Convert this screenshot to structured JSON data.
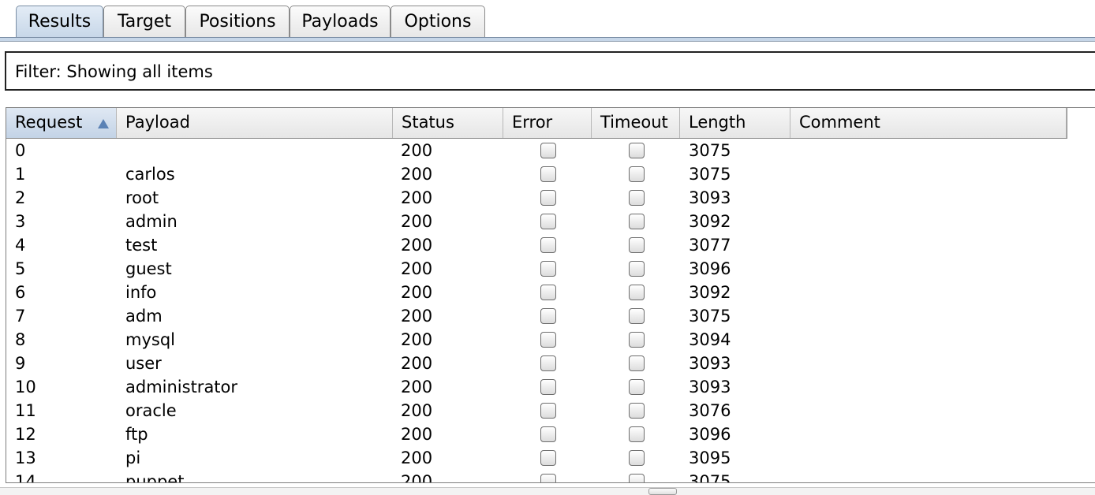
{
  "tabs": [
    {
      "label": "Results",
      "active": true
    },
    {
      "label": "Target",
      "active": false
    },
    {
      "label": "Positions",
      "active": false
    },
    {
      "label": "Payloads",
      "active": false
    },
    {
      "label": "Options",
      "active": false
    }
  ],
  "filter": {
    "text": "Filter: Showing all items"
  },
  "table": {
    "columns": [
      "Request",
      "Payload",
      "Status",
      "Error",
      "Timeout",
      "Length",
      "Comment"
    ],
    "sort": {
      "column": "Request",
      "direction": "ascending"
    },
    "rows": [
      {
        "request": "0",
        "payload": "",
        "status": "200",
        "error": false,
        "timeout": false,
        "length": "3075",
        "comment": ""
      },
      {
        "request": "1",
        "payload": "carlos",
        "status": "200",
        "error": false,
        "timeout": false,
        "length": "3075",
        "comment": ""
      },
      {
        "request": "2",
        "payload": "root",
        "status": "200",
        "error": false,
        "timeout": false,
        "length": "3093",
        "comment": ""
      },
      {
        "request": "3",
        "payload": "admin",
        "status": "200",
        "error": false,
        "timeout": false,
        "length": "3092",
        "comment": ""
      },
      {
        "request": "4",
        "payload": "test",
        "status": "200",
        "error": false,
        "timeout": false,
        "length": "3077",
        "comment": ""
      },
      {
        "request": "5",
        "payload": "guest",
        "status": "200",
        "error": false,
        "timeout": false,
        "length": "3096",
        "comment": ""
      },
      {
        "request": "6",
        "payload": "info",
        "status": "200",
        "error": false,
        "timeout": false,
        "length": "3092",
        "comment": ""
      },
      {
        "request": "7",
        "payload": "adm",
        "status": "200",
        "error": false,
        "timeout": false,
        "length": "3075",
        "comment": ""
      },
      {
        "request": "8",
        "payload": "mysql",
        "status": "200",
        "error": false,
        "timeout": false,
        "length": "3094",
        "comment": ""
      },
      {
        "request": "9",
        "payload": "user",
        "status": "200",
        "error": false,
        "timeout": false,
        "length": "3093",
        "comment": ""
      },
      {
        "request": "10",
        "payload": "administrator",
        "status": "200",
        "error": false,
        "timeout": false,
        "length": "3093",
        "comment": ""
      },
      {
        "request": "11",
        "payload": "oracle",
        "status": "200",
        "error": false,
        "timeout": false,
        "length": "3076",
        "comment": ""
      },
      {
        "request": "12",
        "payload": "ftp",
        "status": "200",
        "error": false,
        "timeout": false,
        "length": "3096",
        "comment": ""
      },
      {
        "request": "13",
        "payload": "pi",
        "status": "200",
        "error": false,
        "timeout": false,
        "length": "3095",
        "comment": ""
      },
      {
        "request": "14",
        "payload": "puppet",
        "status": "200",
        "error": false,
        "timeout": false,
        "length": "3075",
        "comment": ""
      }
    ]
  }
}
